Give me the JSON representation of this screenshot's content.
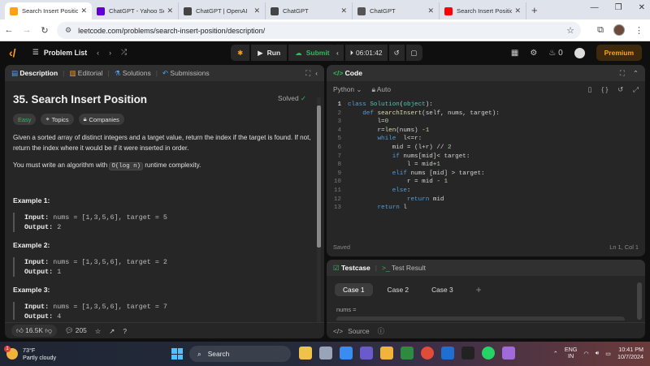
{
  "browser": {
    "tabs": [
      {
        "title": "Search Insert Positio",
        "active": true,
        "favicon_color": "#ffa116"
      },
      {
        "title": "ChatGPT - Yahoo Sea",
        "active": false,
        "favicon_color": "#6001d2"
      },
      {
        "title": "ChatGPT | OpenAI",
        "active": false,
        "favicon_color": "#444444"
      },
      {
        "title": "ChatGPT",
        "active": false,
        "favicon_color": "#444444"
      },
      {
        "title": "ChatGPT",
        "active": false,
        "favicon_color": "#555555"
      },
      {
        "title": "Search Insert Positio",
        "active": false,
        "favicon_color": "#ff0000"
      }
    ],
    "url": "leetcode.com/problems/search-insert-position/description/"
  },
  "header": {
    "problem_list_label": "Problem List",
    "run_label": "Run",
    "submit_label": "Submit",
    "timer": "06:01:42",
    "streak": "0",
    "premium_label": "Premium"
  },
  "left_panel": {
    "tabs": [
      "Description",
      "Editorial",
      "Solutions",
      "Submissions"
    ],
    "title": "35. Search Insert Position",
    "solved_label": "Solved",
    "tags": [
      "Easy",
      "Topics",
      "Companies"
    ],
    "desc1": "Given a sorted array of distinct integers and a target value, return the index if the target is found. If not, return the index where it would be if it were inserted in order.",
    "desc2_pre": "You must write an algorithm with ",
    "desc2_code": "O(log n)",
    "desc2_post": " runtime complexity.",
    "examples": [
      {
        "title": "Example 1:",
        "input": "nums = [1,3,5,6], target = 5",
        "output": "2"
      },
      {
        "title": "Example 2:",
        "input": "nums = [1,3,5,6], target = 2",
        "output": "1"
      },
      {
        "title": "Example 3:",
        "input": "nums = [1,3,5,6], target = 7",
        "output": "4"
      }
    ],
    "input_label": "Input:",
    "output_label": "Output:",
    "likes": "16.5K",
    "comments": "205"
  },
  "code_panel": {
    "title": "Code",
    "language": "Python",
    "mode": "Auto",
    "lines": [
      "class Solution(object):",
      "    def searchInsert(self, nums, target):",
      "        l=0",
      "        r=len(nums) -1",
      "        while  l<=r:",
      "            mid = (l+r) // 2",
      "            if nums[mid]< target:",
      "                l = mid+1",
      "            elif nums [mid] > target:",
      "                r = mid - 1",
      "            else:",
      "                return mid",
      "        return l"
    ],
    "status": "Saved",
    "cursor": "Ln 1, Col 1"
  },
  "test_panel": {
    "tab_testcase": "Testcase",
    "tab_result": "Test Result",
    "cases": [
      "Case 1",
      "Case 2",
      "Case 3"
    ],
    "nums_label": "nums =",
    "source_label": "Source"
  },
  "taskbar": {
    "temp": "73°F",
    "weather": "Partly cloudy",
    "search_label": "Search",
    "lang1": "ENG",
    "lang2": "IN",
    "time": "10:41 PM",
    "date": "10/7/2024"
  }
}
